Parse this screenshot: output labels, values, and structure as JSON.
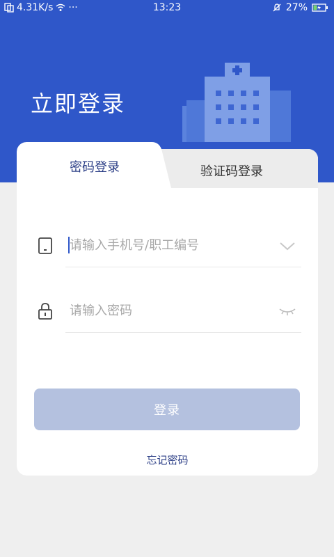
{
  "status_bar": {
    "network_speed": "4.31K/s",
    "more": "···",
    "time": "13:23",
    "battery": "27%"
  },
  "header": {
    "title": "立即登录"
  },
  "tabs": [
    {
      "label": "密码登录",
      "active": true
    },
    {
      "label": "验证码登录",
      "active": false
    }
  ],
  "form": {
    "phone": {
      "placeholder": "请输入手机号/职工编号",
      "value": ""
    },
    "password": {
      "placeholder": "请输入密码",
      "value": ""
    }
  },
  "login_button": {
    "label": "登录"
  },
  "forgot_link": {
    "label": "忘记密码"
  },
  "colors": {
    "brand_blue": "#2f57c9",
    "text_dark_blue": "#2b3e86",
    "button_disabled": "#b4c1df"
  }
}
